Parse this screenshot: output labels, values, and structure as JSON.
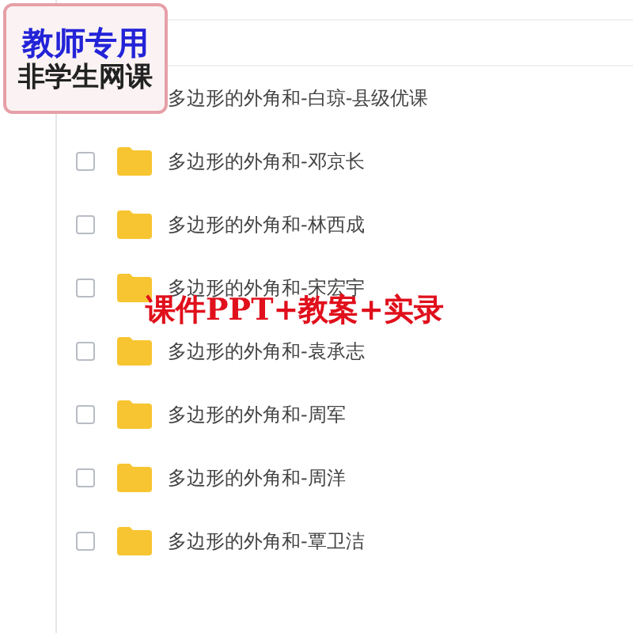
{
  "badge": {
    "lines": [
      "教师专用",
      "非学生网课"
    ]
  },
  "files": [
    {
      "name": "多边形的外角和-白琼-县级优课"
    },
    {
      "name": "多边形的外角和-邓京长",
      "checked": false
    },
    {
      "name": "多边形的外角和-林西成",
      "checked": false
    },
    {
      "name": "多边形的外角和-宋宏宇",
      "checked": false
    },
    {
      "name": "多边形的外角和-袁承志",
      "checked": false
    },
    {
      "name": "多边形的外角和-周军",
      "checked": false
    },
    {
      "name": "多边形的外角和-周洋",
      "checked": false
    },
    {
      "name": "多边形的外角和-覃卫洁",
      "checked": false
    }
  ],
  "banner": "课件PPT+教案+实录"
}
